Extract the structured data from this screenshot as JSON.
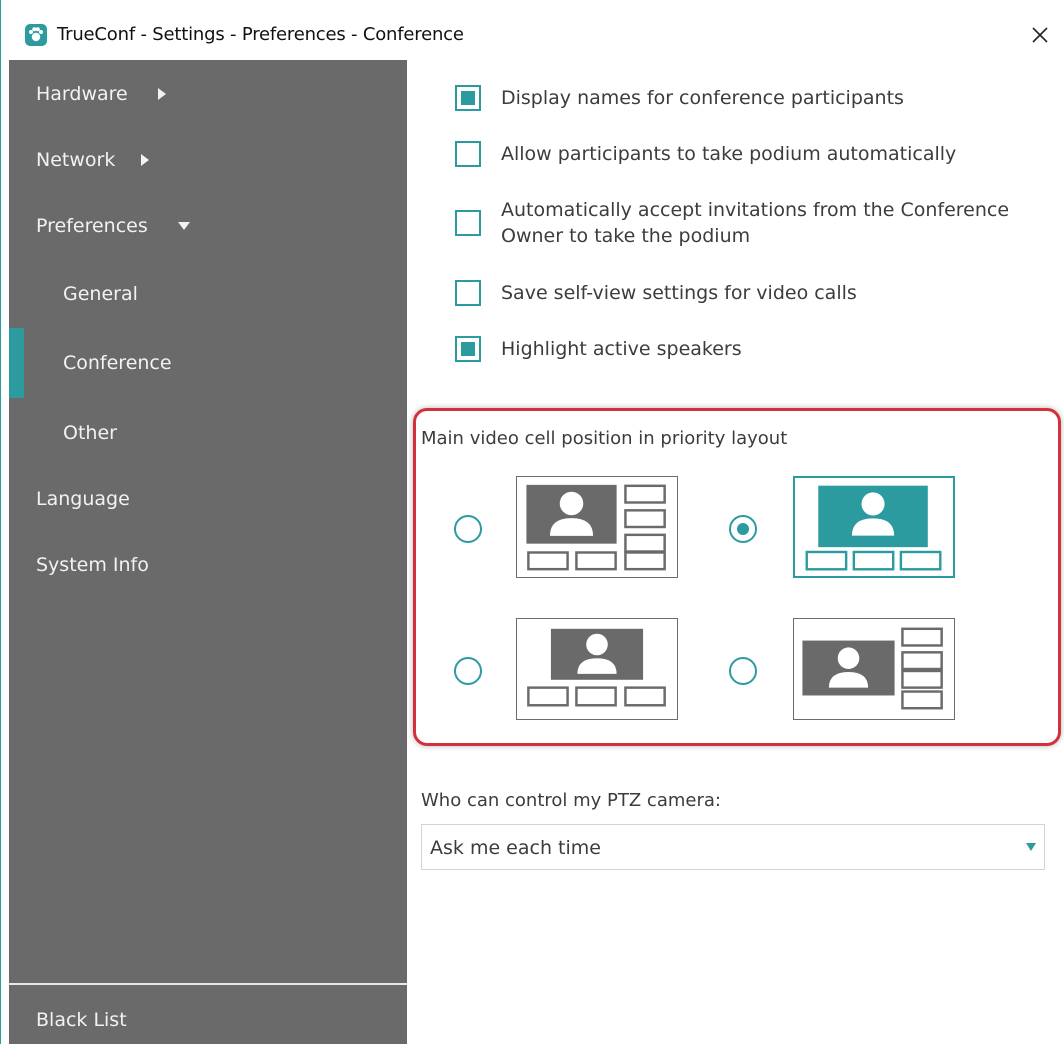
{
  "window": {
    "title": "TrueConf - Settings - Preferences - Conference",
    "icons": {
      "app": "trueconf-logo-icon",
      "close": "close-icon"
    }
  },
  "sidebar": {
    "items": [
      {
        "label": "Hardware",
        "icon": "caret-right-icon"
      },
      {
        "label": "Network",
        "icon": "caret-right-icon"
      },
      {
        "label": "Preferences",
        "icon": "caret-down-icon"
      },
      {
        "label": "General"
      },
      {
        "label": "Conference",
        "active": true
      },
      {
        "label": "Other"
      },
      {
        "label": "Language"
      },
      {
        "label": "System Info"
      }
    ],
    "bottom_item": {
      "label": "Black List"
    }
  },
  "conference": {
    "options": [
      {
        "label": "Display names for conference participants",
        "checked": true
      },
      {
        "label": "Allow participants to take podium automatically",
        "checked": false
      },
      {
        "label": "Automatically accept invitations from the Conference Owner to take the podium",
        "checked": false
      },
      {
        "label": "Save self-view settings for video calls",
        "checked": false
      },
      {
        "label": "Highlight active speakers",
        "checked": true
      }
    ],
    "layout": {
      "title": "Main video cell position in priority layout",
      "options": [
        {
          "name": "top-left-main",
          "selected": false
        },
        {
          "name": "top-wide-main",
          "selected": true
        },
        {
          "name": "top-centered-main",
          "selected": false
        },
        {
          "name": "left-main-right-column",
          "selected": false
        }
      ]
    },
    "ptz": {
      "label": "Who can control my PTZ camera:",
      "value": "Ask me each time"
    }
  },
  "colors": {
    "accent": "#2c9ba0",
    "sidebar_bg": "#6a6a6a",
    "highlight_border": "#d1313b"
  }
}
